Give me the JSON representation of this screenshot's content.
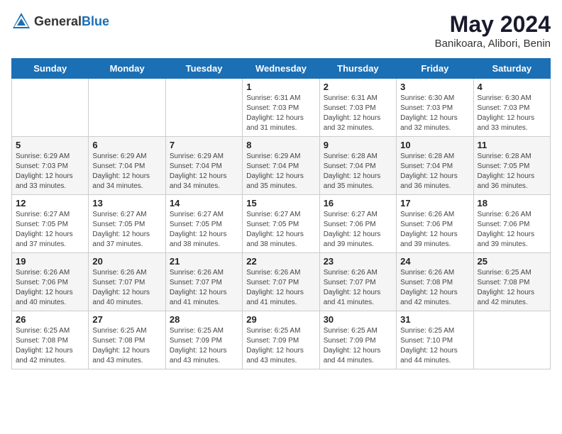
{
  "logo": {
    "text_general": "General",
    "text_blue": "Blue"
  },
  "title": "May 2024",
  "subtitle": "Banikoara, Alibori, Benin",
  "days_of_week": [
    "Sunday",
    "Monday",
    "Tuesday",
    "Wednesday",
    "Thursday",
    "Friday",
    "Saturday"
  ],
  "weeks": [
    [
      {
        "day": "",
        "info": ""
      },
      {
        "day": "",
        "info": ""
      },
      {
        "day": "",
        "info": ""
      },
      {
        "day": "1",
        "info": "Sunrise: 6:31 AM\nSunset: 7:03 PM\nDaylight: 12 hours\nand 31 minutes."
      },
      {
        "day": "2",
        "info": "Sunrise: 6:31 AM\nSunset: 7:03 PM\nDaylight: 12 hours\nand 32 minutes."
      },
      {
        "day": "3",
        "info": "Sunrise: 6:30 AM\nSunset: 7:03 PM\nDaylight: 12 hours\nand 32 minutes."
      },
      {
        "day": "4",
        "info": "Sunrise: 6:30 AM\nSunset: 7:03 PM\nDaylight: 12 hours\nand 33 minutes."
      }
    ],
    [
      {
        "day": "5",
        "info": "Sunrise: 6:29 AM\nSunset: 7:03 PM\nDaylight: 12 hours\nand 33 minutes."
      },
      {
        "day": "6",
        "info": "Sunrise: 6:29 AM\nSunset: 7:04 PM\nDaylight: 12 hours\nand 34 minutes."
      },
      {
        "day": "7",
        "info": "Sunrise: 6:29 AM\nSunset: 7:04 PM\nDaylight: 12 hours\nand 34 minutes."
      },
      {
        "day": "8",
        "info": "Sunrise: 6:29 AM\nSunset: 7:04 PM\nDaylight: 12 hours\nand 35 minutes."
      },
      {
        "day": "9",
        "info": "Sunrise: 6:28 AM\nSunset: 7:04 PM\nDaylight: 12 hours\nand 35 minutes."
      },
      {
        "day": "10",
        "info": "Sunrise: 6:28 AM\nSunset: 7:04 PM\nDaylight: 12 hours\nand 36 minutes."
      },
      {
        "day": "11",
        "info": "Sunrise: 6:28 AM\nSunset: 7:05 PM\nDaylight: 12 hours\nand 36 minutes."
      }
    ],
    [
      {
        "day": "12",
        "info": "Sunrise: 6:27 AM\nSunset: 7:05 PM\nDaylight: 12 hours\nand 37 minutes."
      },
      {
        "day": "13",
        "info": "Sunrise: 6:27 AM\nSunset: 7:05 PM\nDaylight: 12 hours\nand 37 minutes."
      },
      {
        "day": "14",
        "info": "Sunrise: 6:27 AM\nSunset: 7:05 PM\nDaylight: 12 hours\nand 38 minutes."
      },
      {
        "day": "15",
        "info": "Sunrise: 6:27 AM\nSunset: 7:05 PM\nDaylight: 12 hours\nand 38 minutes."
      },
      {
        "day": "16",
        "info": "Sunrise: 6:27 AM\nSunset: 7:06 PM\nDaylight: 12 hours\nand 39 minutes."
      },
      {
        "day": "17",
        "info": "Sunrise: 6:26 AM\nSunset: 7:06 PM\nDaylight: 12 hours\nand 39 minutes."
      },
      {
        "day": "18",
        "info": "Sunrise: 6:26 AM\nSunset: 7:06 PM\nDaylight: 12 hours\nand 39 minutes."
      }
    ],
    [
      {
        "day": "19",
        "info": "Sunrise: 6:26 AM\nSunset: 7:06 PM\nDaylight: 12 hours\nand 40 minutes."
      },
      {
        "day": "20",
        "info": "Sunrise: 6:26 AM\nSunset: 7:07 PM\nDaylight: 12 hours\nand 40 minutes."
      },
      {
        "day": "21",
        "info": "Sunrise: 6:26 AM\nSunset: 7:07 PM\nDaylight: 12 hours\nand 41 minutes."
      },
      {
        "day": "22",
        "info": "Sunrise: 6:26 AM\nSunset: 7:07 PM\nDaylight: 12 hours\nand 41 minutes."
      },
      {
        "day": "23",
        "info": "Sunrise: 6:26 AM\nSunset: 7:07 PM\nDaylight: 12 hours\nand 41 minutes."
      },
      {
        "day": "24",
        "info": "Sunrise: 6:26 AM\nSunset: 7:08 PM\nDaylight: 12 hours\nand 42 minutes."
      },
      {
        "day": "25",
        "info": "Sunrise: 6:25 AM\nSunset: 7:08 PM\nDaylight: 12 hours\nand 42 minutes."
      }
    ],
    [
      {
        "day": "26",
        "info": "Sunrise: 6:25 AM\nSunset: 7:08 PM\nDaylight: 12 hours\nand 42 minutes."
      },
      {
        "day": "27",
        "info": "Sunrise: 6:25 AM\nSunset: 7:08 PM\nDaylight: 12 hours\nand 43 minutes."
      },
      {
        "day": "28",
        "info": "Sunrise: 6:25 AM\nSunset: 7:09 PM\nDaylight: 12 hours\nand 43 minutes."
      },
      {
        "day": "29",
        "info": "Sunrise: 6:25 AM\nSunset: 7:09 PM\nDaylight: 12 hours\nand 43 minutes."
      },
      {
        "day": "30",
        "info": "Sunrise: 6:25 AM\nSunset: 7:09 PM\nDaylight: 12 hours\nand 44 minutes."
      },
      {
        "day": "31",
        "info": "Sunrise: 6:25 AM\nSunset: 7:10 PM\nDaylight: 12 hours\nand 44 minutes."
      },
      {
        "day": "",
        "info": ""
      }
    ]
  ]
}
